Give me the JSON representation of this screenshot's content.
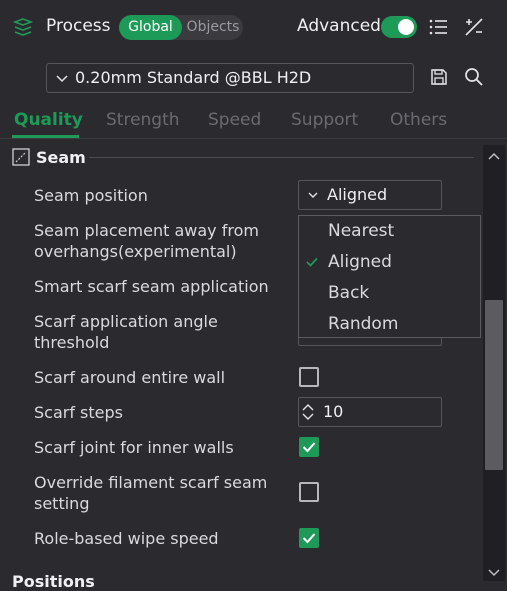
{
  "header": {
    "title": "Process",
    "mode_global": "Global",
    "mode_objects": "Objects",
    "advanced_label": "Advanced",
    "advanced_on": true,
    "accent": "#1e9a58"
  },
  "preset": {
    "value": "0.20mm Standard @BBL H2D"
  },
  "tabs": [
    {
      "label": "Quality",
      "active": true
    },
    {
      "label": "Strength",
      "active": false
    },
    {
      "label": "Speed",
      "active": false
    },
    {
      "label": "Support",
      "active": false
    },
    {
      "label": "Others",
      "active": false
    }
  ],
  "section": {
    "title": "Seam"
  },
  "rows": {
    "seam_position": {
      "label": "Seam position",
      "value": "Aligned"
    },
    "seam_placement": {
      "label_line1": "Seam placement away from",
      "label_line2": "overhangs(experimental)"
    },
    "smart_scarf": {
      "label": "Smart scarf seam application"
    },
    "scarf_angle": {
      "label_line1": "Scarf application angle",
      "label_line2": "threshold"
    },
    "scarf_entire_wall": {
      "label": "Scarf around entire wall",
      "checked": false
    },
    "scarf_steps": {
      "label": "Scarf steps",
      "value": "10"
    },
    "scarf_inner_walls": {
      "label": "Scarf joint for inner walls",
      "checked": true
    },
    "override_filament": {
      "label_line1": "Override filament scarf seam",
      "label_line2": "setting",
      "checked": false
    },
    "role_wipe_speed": {
      "label": "Role-based wipe speed",
      "checked": true
    }
  },
  "dropdown": {
    "options": [
      "Nearest",
      "Aligned",
      "Back",
      "Random"
    ],
    "selected": "Aligned"
  },
  "next_section": {
    "title": "Positions"
  }
}
